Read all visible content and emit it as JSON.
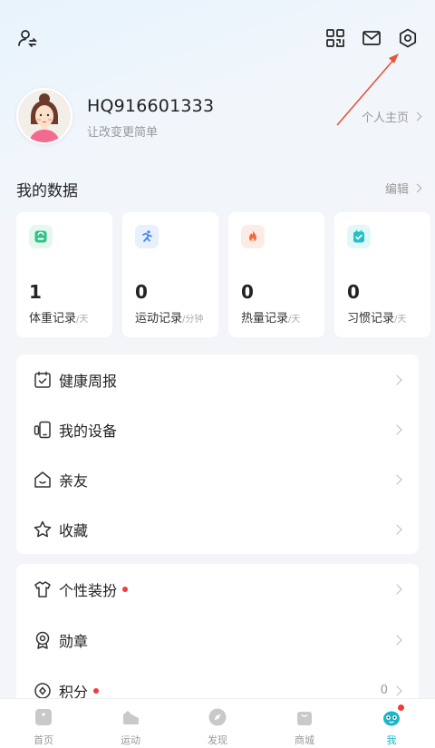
{
  "header": {
    "user_switch_icon": "user-switch-icon",
    "scan_icon": "scan-grid-icon",
    "mail_icon": "mail-icon",
    "settings_icon": "settings-hexagon-icon"
  },
  "profile": {
    "username": "HQ916601333",
    "motto": "让改变更简单",
    "homepage_label": "个人主页"
  },
  "my_data": {
    "title": "我的数据",
    "edit_label": "编辑",
    "cards": [
      {
        "value": "1",
        "label": "体重记录",
        "unit": "/天",
        "icon": "scale-icon",
        "color": "#2fc28a"
      },
      {
        "value": "0",
        "label": "运动记录",
        "unit": "/分钟",
        "icon": "running-icon",
        "color": "#4a86f0"
      },
      {
        "value": "0",
        "label": "热量记录",
        "unit": "/天",
        "icon": "flame-icon",
        "color": "#f4663a"
      },
      {
        "value": "0",
        "label": "习惯记录",
        "unit": "/天",
        "icon": "habit-check-icon",
        "color": "#25c0c8"
      }
    ]
  },
  "group1": {
    "items": [
      {
        "label": "健康周报",
        "icon": "calendar-report-icon"
      },
      {
        "label": "我的设备",
        "icon": "device-icon"
      },
      {
        "label": "亲友",
        "icon": "family-home-icon"
      },
      {
        "label": "收藏",
        "icon": "star-icon"
      }
    ]
  },
  "group2": {
    "items": [
      {
        "label": "个性装扮",
        "icon": "tshirt-icon",
        "dot": true
      },
      {
        "label": "勋章",
        "icon": "medal-icon"
      },
      {
        "label": "积分",
        "icon": "points-coin-icon",
        "dot": true,
        "value": "0"
      }
    ]
  },
  "tabbar": {
    "tabs": [
      {
        "label": "首页",
        "icon": "home-icon"
      },
      {
        "label": "运动",
        "icon": "sneaker-icon"
      },
      {
        "label": "发现",
        "icon": "compass-icon"
      },
      {
        "label": "商城",
        "icon": "shopping-bag-icon"
      },
      {
        "label": "我",
        "icon": "me-mascot-icon",
        "active": true
      }
    ]
  },
  "colors": {
    "accent": "#19b7c6",
    "red_dot": "#f23c3c",
    "annotation_arrow": "#e8543b"
  }
}
